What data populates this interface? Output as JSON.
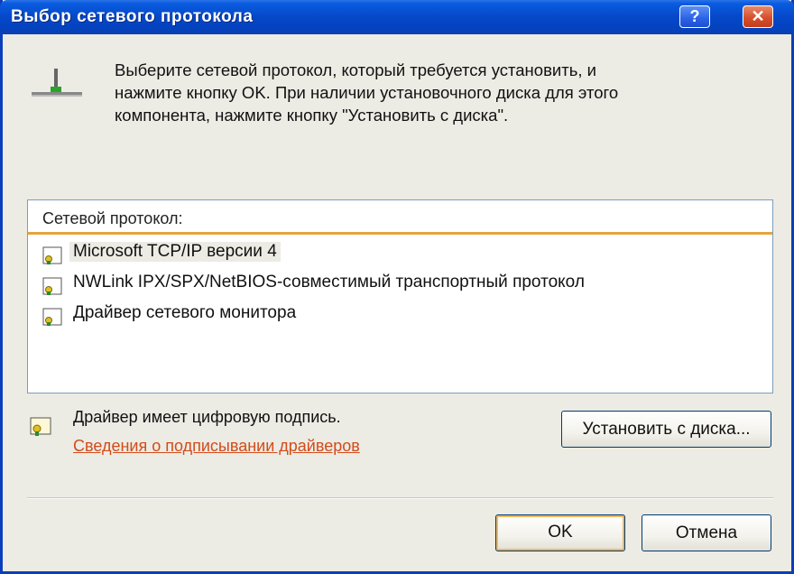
{
  "window": {
    "title": "Выбор сетевого протокола",
    "help_glyph": "?",
    "close_glyph": "✕"
  },
  "intro": {
    "text": "Выберите сетевой протокол, который требуется установить, и\nнажмите кнопку OK. При наличии установочного диска для этого\nкомпонента, нажмите кнопку \"Установить с диска\"."
  },
  "list": {
    "header": "Сетевой протокол:",
    "items": [
      {
        "label": "Microsoft TCP/IP версии 4",
        "selected": true
      },
      {
        "label": "NWLink IPX/SPX/NetBIOS-совместимый транспортный протокол",
        "selected": false
      },
      {
        "label": "Драйвер сетевого монитора",
        "selected": false
      }
    ]
  },
  "driver": {
    "signed_text": "Драйвер имеет цифровую подпись.",
    "link": "Сведения о подписывании драйверов"
  },
  "buttons": {
    "install": "Установить с диска...",
    "ok": "OK",
    "cancel": "Отмена"
  },
  "colors": {
    "titlebar": "#0548c8",
    "accent_link": "#d24c1a",
    "list_header_underline": "#e5a43a"
  },
  "icons": {
    "header": "network-protocol-icon",
    "item": "protocol-certificate-icon",
    "driver": "signed-driver-icon"
  }
}
